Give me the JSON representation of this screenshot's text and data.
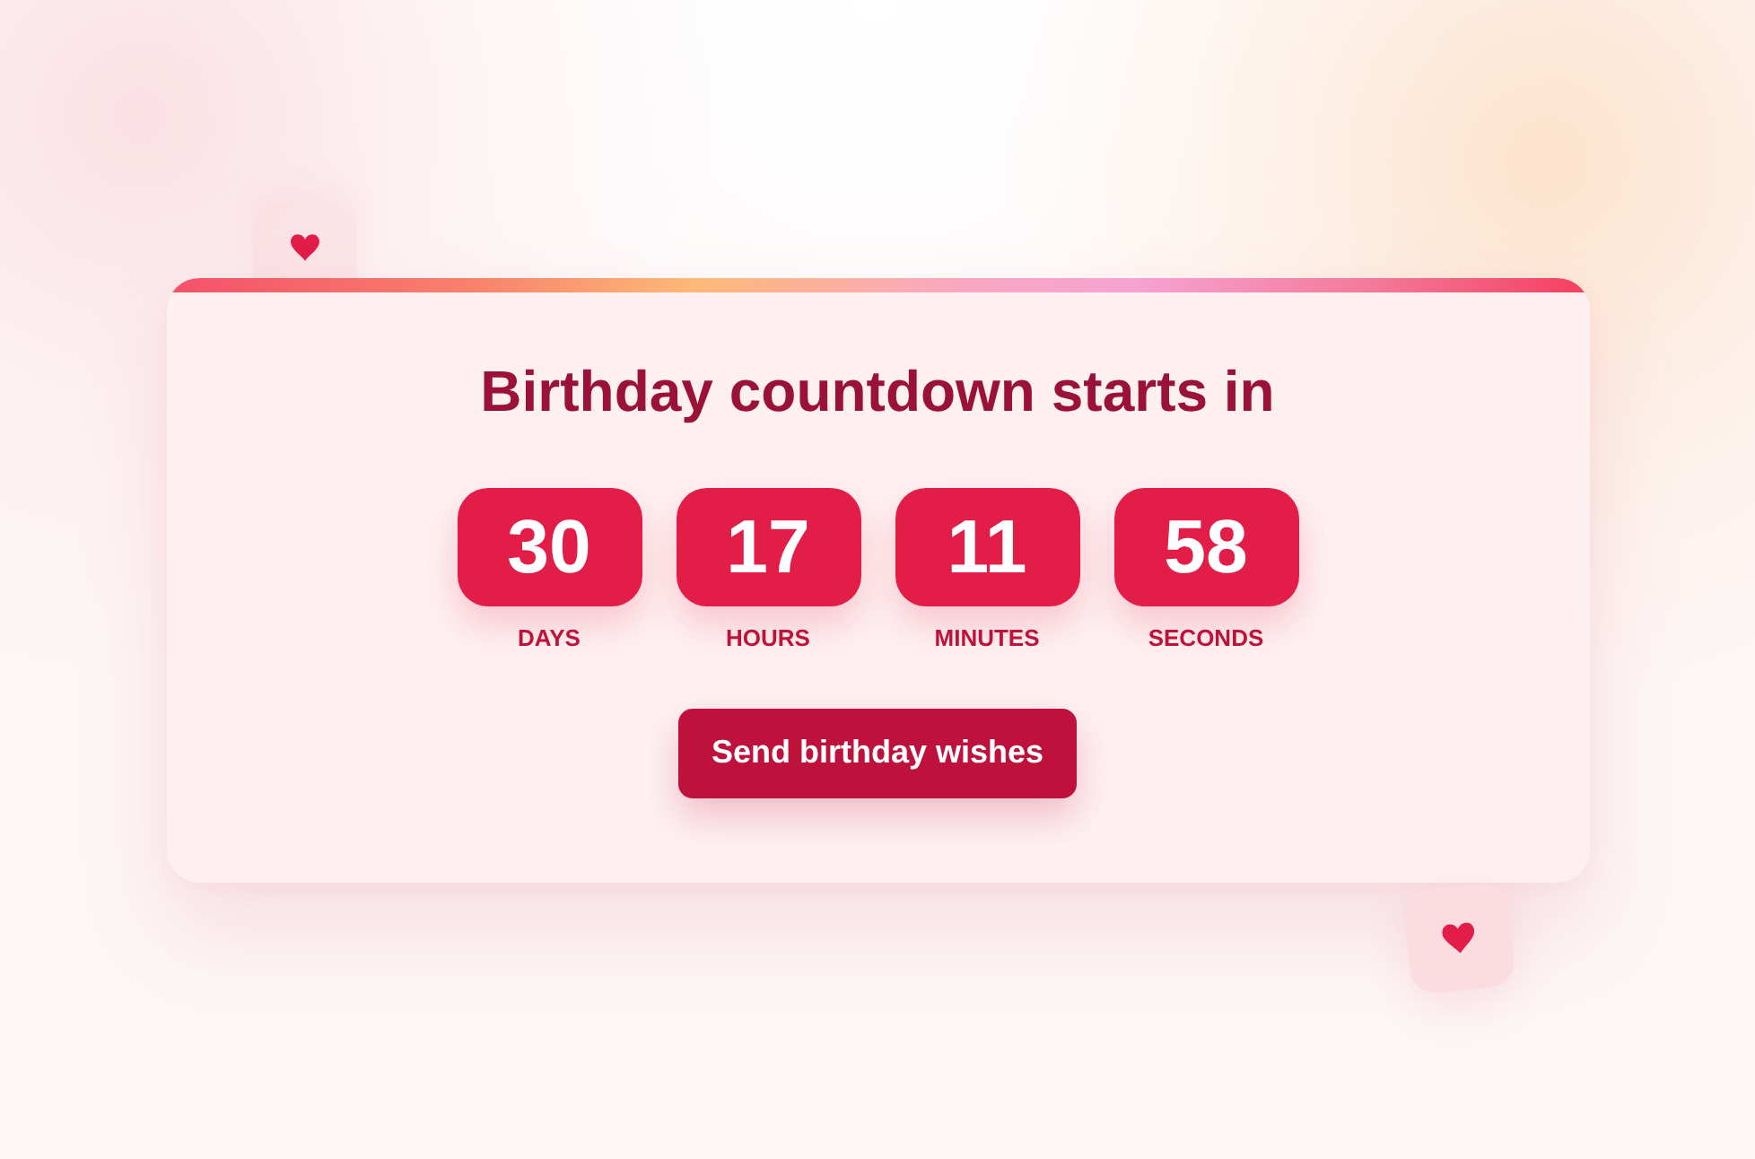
{
  "card": {
    "title": "Birthday countdown starts in",
    "units": [
      {
        "value": "30",
        "label": "DAYS"
      },
      {
        "value": "17",
        "label": "HOURS"
      },
      {
        "value": "11",
        "label": "MINUTES"
      },
      {
        "value": "58",
        "label": "SECONDS"
      }
    ],
    "button": {
      "label": "Send birthday wishes"
    }
  }
}
